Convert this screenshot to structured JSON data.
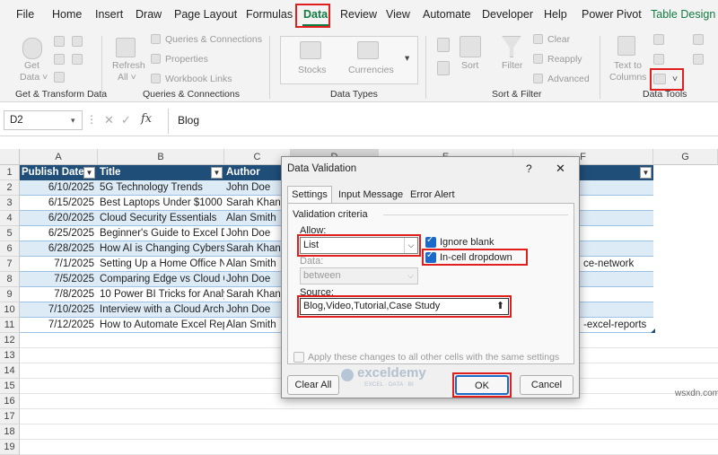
{
  "ribbon_tabs": [
    "File",
    "Home",
    "Insert",
    "Draw",
    "Page Layout",
    "Formulas",
    "Data",
    "Review",
    "View",
    "Automate",
    "Developer",
    "Help",
    "Power Pivot",
    "Table Design"
  ],
  "ribbon": {
    "get_data": "Get",
    "get_data2": "Data ˅",
    "refresh": "Refresh",
    "refresh2": "All ˅",
    "queries_connections": "Queries & Connections",
    "properties": "Properties",
    "workbook_links": "Workbook Links",
    "stocks": "Stocks",
    "currencies": "Currencies",
    "sort": "Sort",
    "filter": "Filter",
    "clear": "Clear",
    "reapply": "Reapply",
    "advanced": "Advanced",
    "text_to": "Text to",
    "columns": "Columns",
    "groups": [
      "Get & Transform Data",
      "Queries & Connections",
      "Data Types",
      "Sort & Filter",
      "Data Tools"
    ]
  },
  "formula_bar": {
    "name_box": "D2",
    "fx": "fx",
    "content": "Blog"
  },
  "columns": [
    "A",
    "B",
    "C",
    "D",
    "E",
    "F",
    "G"
  ],
  "headers": [
    "Publish Date",
    "Title",
    "Author"
  ],
  "rows": [
    {
      "n": "2",
      "date": "6/10/2025",
      "title": "5G Technology Trends",
      "author": "John Doe",
      "right": ""
    },
    {
      "n": "3",
      "date": "6/15/2025",
      "title": "Best Laptops Under $1000",
      "author": "Sarah Khan",
      "right": ""
    },
    {
      "n": "4",
      "date": "6/20/2025",
      "title": "Cloud Security Essentials",
      "author": "Alan Smith",
      "right": ""
    },
    {
      "n": "5",
      "date": "6/25/2025",
      "title": "Beginner's Guide to Excel D",
      "author": "John Doe",
      "right": ""
    },
    {
      "n": "6",
      "date": "6/28/2025",
      "title": "How AI is Changing Cybersec",
      "author": "Sarah Khan",
      "right": ""
    },
    {
      "n": "7",
      "date": "7/1/2025",
      "title": "Setting Up a Home Office N",
      "author": "Alan Smith",
      "right": "ce-network"
    },
    {
      "n": "8",
      "date": "7/5/2025",
      "title": "Comparing Edge vs Cloud C",
      "author": "John Doe",
      "right": ""
    },
    {
      "n": "9",
      "date": "7/8/2025",
      "title": "10 Power BI Tricks for Analy",
      "author": "Sarah Khan",
      "right": ""
    },
    {
      "n": "10",
      "date": "7/10/2025",
      "title": "Interview with a Cloud Arch",
      "author": "John Doe",
      "right": ""
    },
    {
      "n": "11",
      "date": "7/12/2025",
      "title": "How to Automate Excel Rep",
      "author": "Alan Smith",
      "right": "-excel-reports"
    }
  ],
  "empty_rows": [
    "12",
    "13",
    "14",
    "15",
    "16",
    "17",
    "18",
    "19"
  ],
  "dialog": {
    "title": "Data Validation",
    "help": "?",
    "close": "✕",
    "tabs": [
      "Settings",
      "Input Message",
      "Error Alert"
    ],
    "criteria_label": "Validation criteria",
    "allow_label": "Allow:",
    "allow_value": "List",
    "data_label": "Data:",
    "data_value": "between",
    "ignore_blank": "Ignore blank",
    "in_cell_dropdown": "In-cell dropdown",
    "source_label": "Source:",
    "source_value": "Blog,Video,Tutorial,Case Study",
    "apply_all": "Apply these changes to all other cells with the same settings",
    "clear_all": "Clear All",
    "ok": "OK",
    "cancel": "Cancel"
  },
  "watermark": {
    "name": "exceldemy",
    "tagline": "EXCEL · DATA · BI"
  },
  "footer": "wsxdn.com",
  "colors": {
    "header_blue": "#1f4e79",
    "band": "#ddebf7",
    "accent": "#107c41",
    "red": "#e01f1f",
    "checkbox": "#1b6ac9"
  }
}
